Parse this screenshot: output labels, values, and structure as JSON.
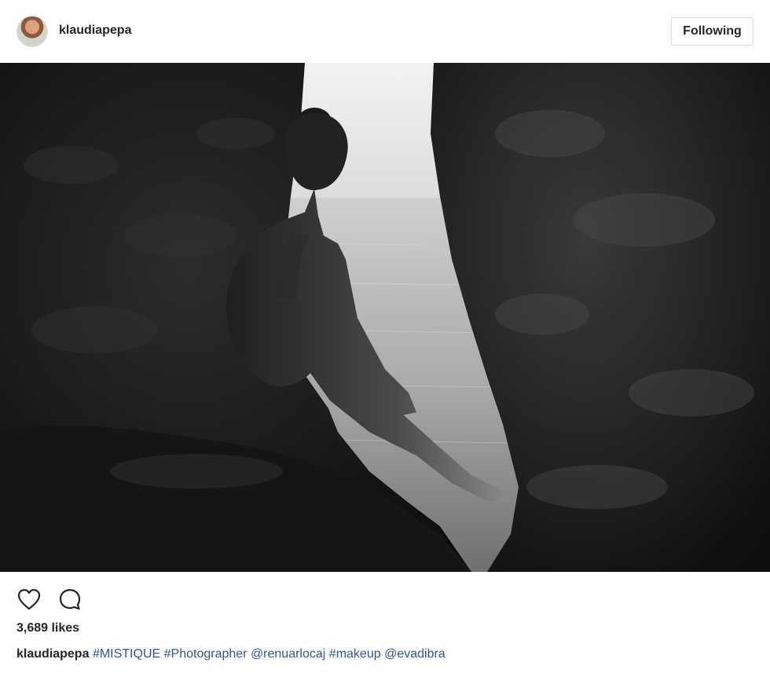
{
  "post": {
    "username": "klaudiapepa",
    "follow_label": "Following",
    "likes": "3,689 likes",
    "caption_user": "klaudiapepa",
    "caption_tags": [
      "#MISTIQUE",
      "#Photographer",
      "@renuarlocaj",
      "#makeup",
      "@evadibra"
    ]
  },
  "icons": {
    "like": "heart-outline-icon",
    "comment": "speech-bubble-outline-icon"
  },
  "colors": {
    "link": "#30569b",
    "text": "#262626",
    "border": "#dbdbdb"
  }
}
